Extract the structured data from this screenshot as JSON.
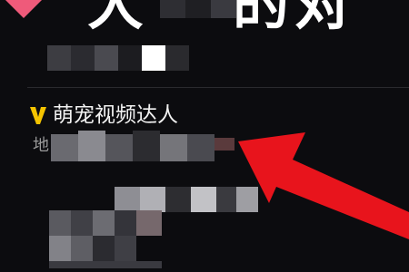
{
  "header": {
    "title_left": "大",
    "title_right": "的对"
  },
  "badge": {
    "label": "萌宠视频达人"
  },
  "bio": {
    "prefix": "地"
  },
  "colors": {
    "background": "#0c0c0f",
    "badge_v": "#f5c400",
    "heart": "#ef5a7a",
    "arrow": "#e8141c"
  }
}
